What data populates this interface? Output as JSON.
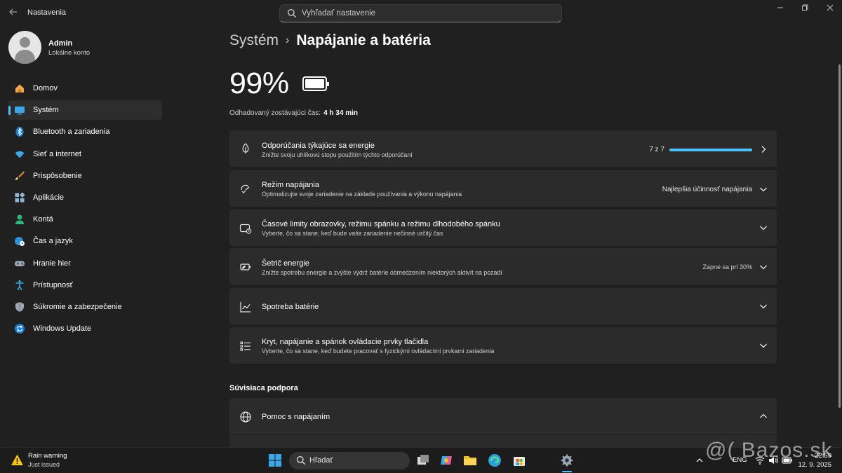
{
  "window": {
    "title": "Nastavenia",
    "search_placeholder": "Vyhľadať nastavenie"
  },
  "profile": {
    "name": "Admin",
    "account_type": "Lokálne konto"
  },
  "sidebar": {
    "items": [
      {
        "label": "Domov",
        "icon": "home-icon"
      },
      {
        "label": "Systém",
        "icon": "system-icon",
        "active": true
      },
      {
        "label": "Bluetooth a zariadenia",
        "icon": "bluetooth-icon"
      },
      {
        "label": "Sieť a internet",
        "icon": "wifi-icon"
      },
      {
        "label": "Prispôsobenie",
        "icon": "brush-icon"
      },
      {
        "label": "Aplikácie",
        "icon": "apps-icon"
      },
      {
        "label": "Kontá",
        "icon": "account-icon"
      },
      {
        "label": "Čas a jazyk",
        "icon": "globe-clock-icon"
      },
      {
        "label": "Hranie hier",
        "icon": "gamepad-icon"
      },
      {
        "label": "Prístupnosť",
        "icon": "accessibility-icon"
      },
      {
        "label": "Súkromie a zabezpečenie",
        "icon": "shield-icon"
      },
      {
        "label": "Windows Update",
        "icon": "update-icon"
      }
    ]
  },
  "breadcrumb": {
    "parent": "Systém",
    "separator": "›",
    "current": "Napájanie a batéria"
  },
  "battery": {
    "percent_label": "99%",
    "level": 0.99,
    "estimate_label": "Odhadovaný zostávajúci čas:",
    "estimate_value": "4 h 34 min"
  },
  "cards": [
    {
      "title": "Odporúčania týkajúce sa energie",
      "subtitle": "Znížte svoju uhlíkovú stopu použitím týchto odporúčaní",
      "right": "7 z 7",
      "progress": 1.0,
      "icon": "leaf-icon",
      "chevron": "chevron-right-icon"
    },
    {
      "title": "Režim napájania",
      "subtitle": "Optimalizujte svoje zariadenie na základe používania a výkonu napájania",
      "right": "Najlepšia účinnosť napájania",
      "icon": "power-mode-icon",
      "chevron": "chevron-down-icon"
    },
    {
      "title": "Časové limity obrazovky, režimu spánku a režimu dlhodobého spánku",
      "subtitle": "Vyberte, čo sa stane, keď bude vaše zariadenie nečinné určitý čas",
      "right": "",
      "icon": "screen-sleep-icon",
      "chevron": "chevron-down-icon"
    },
    {
      "title": "Šetrič energie",
      "subtitle": "Znížte spotrebu energie a zvýšte výdrž batérie obmedzením niektorých aktivít na pozadí",
      "right": "Zapne sa pri 30%",
      "icon": "battery-saver-icon",
      "chevron": "chevron-down-icon"
    },
    {
      "title": "Spotreba batérie",
      "subtitle": "",
      "right": "",
      "icon": "chart-icon",
      "chevron": "chevron-down-icon"
    },
    {
      "title": "Kryt, napájanie a spánok ovládacie prvky tlačidla",
      "subtitle": "Vyberte, čo sa stane, keď budete pracovať s fyzickými ovládacími prvkami zariadenia",
      "right": "",
      "icon": "list-icon",
      "chevron": "chevron-down-icon"
    }
  ],
  "related": {
    "heading": "Súvisiaca podpora",
    "help_title": "Pomoc s napájaním"
  },
  "taskbar": {
    "weather_title": "Rain warning",
    "weather_sub": "Just issued",
    "search_placeholder": "Hľadať",
    "language": "ENG",
    "time": "22:59",
    "date": "12. 9. 2025"
  },
  "watermark": "@( Bazos.sk",
  "colors": {
    "accent": "#4cc2ff",
    "background": "#202020",
    "card": "#2b2b2b"
  }
}
